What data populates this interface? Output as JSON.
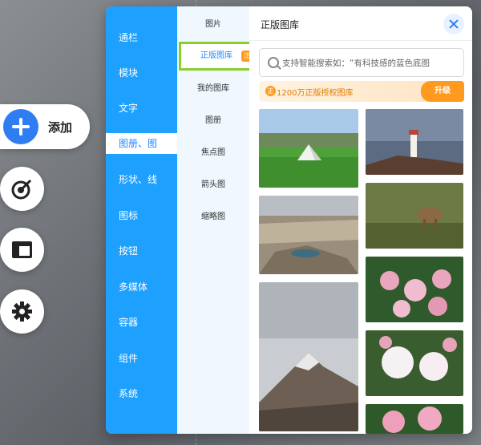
{
  "toolbar": {
    "add_label": "添加"
  },
  "categories": [
    "通栏",
    "模块",
    "文字",
    "图册、图",
    "形状、线",
    "图标",
    "按钮",
    "多媒体",
    "容器",
    "组件",
    "系统"
  ],
  "sub_tabs": [
    "图片",
    "正版图库",
    "我的图库",
    "图册",
    "焦点图",
    "箭头图",
    "缩略图"
  ],
  "sub_badge": "正",
  "content": {
    "title": "正版图库",
    "search_placeholder": "支持智能搜索如：“有科技感的蓝色底图",
    "promo_badge": "正",
    "promo_text": "1200万正版授权图库",
    "promo_button": "升级"
  },
  "colors": {
    "accent": "#1ea0ff",
    "active_text": "#1e88ff",
    "highlight_border": "#8ad02c",
    "promo": "#ff9a1f"
  }
}
